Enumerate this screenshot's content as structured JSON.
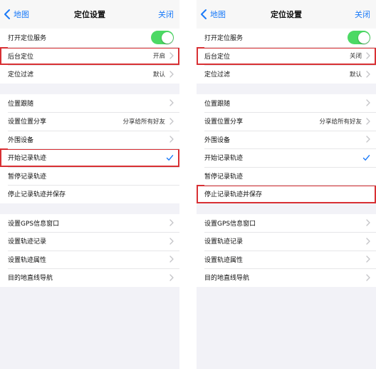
{
  "panels": [
    {
      "nav": {
        "back_label": "地图",
        "title": "定位设置",
        "close_label": "关闭"
      },
      "group1": [
        {
          "label": "打开定位服务",
          "toggle": true
        },
        {
          "label": "后台定位",
          "value": "开启",
          "highlighted": true
        },
        {
          "label": "定位过滤",
          "value": "默认"
        }
      ],
      "group2": [
        {
          "label": "位置跟随"
        },
        {
          "label": "设置位置分享",
          "value": "分享给所有好友"
        },
        {
          "label": "外围设备"
        },
        {
          "label": "开始记录轨迹",
          "checked": true,
          "highlighted": true
        },
        {
          "label": "暂停记录轨迹"
        },
        {
          "label": "停止记录轨迹并保存"
        }
      ],
      "group3": [
        {
          "label": "设置GPS信息窗口"
        },
        {
          "label": "设置轨迹记录"
        },
        {
          "label": "设置轨迹属性"
        },
        {
          "label": "目的地直线导航"
        }
      ]
    },
    {
      "nav": {
        "back_label": "地图",
        "title": "定位设置",
        "close_label": "关闭"
      },
      "group1": [
        {
          "label": "打开定位服务",
          "toggle": true
        },
        {
          "label": "后台定位",
          "value": "关闭",
          "highlighted": true
        },
        {
          "label": "定位过滤",
          "value": "默认"
        }
      ],
      "group2": [
        {
          "label": "位置跟随"
        },
        {
          "label": "设置位置分享",
          "value": "分享给所有好友"
        },
        {
          "label": "外围设备"
        },
        {
          "label": "开始记录轨迹",
          "checked": true
        },
        {
          "label": "暂停记录轨迹"
        },
        {
          "label": "停止记录轨迹并保存",
          "highlighted": true
        }
      ],
      "group3": [
        {
          "label": "设置GPS信息窗口"
        },
        {
          "label": "设置轨迹记录"
        },
        {
          "label": "设置轨迹属性"
        },
        {
          "label": "目的地直线导航"
        }
      ]
    }
  ],
  "colors": {
    "accent": "#1a7af8",
    "toggle_on": "#4cd964",
    "highlight": "#d83034"
  },
  "icons": {
    "back": "chevron-left-icon",
    "disclosure": "chevron-right-icon",
    "check": "checkmark-icon"
  }
}
